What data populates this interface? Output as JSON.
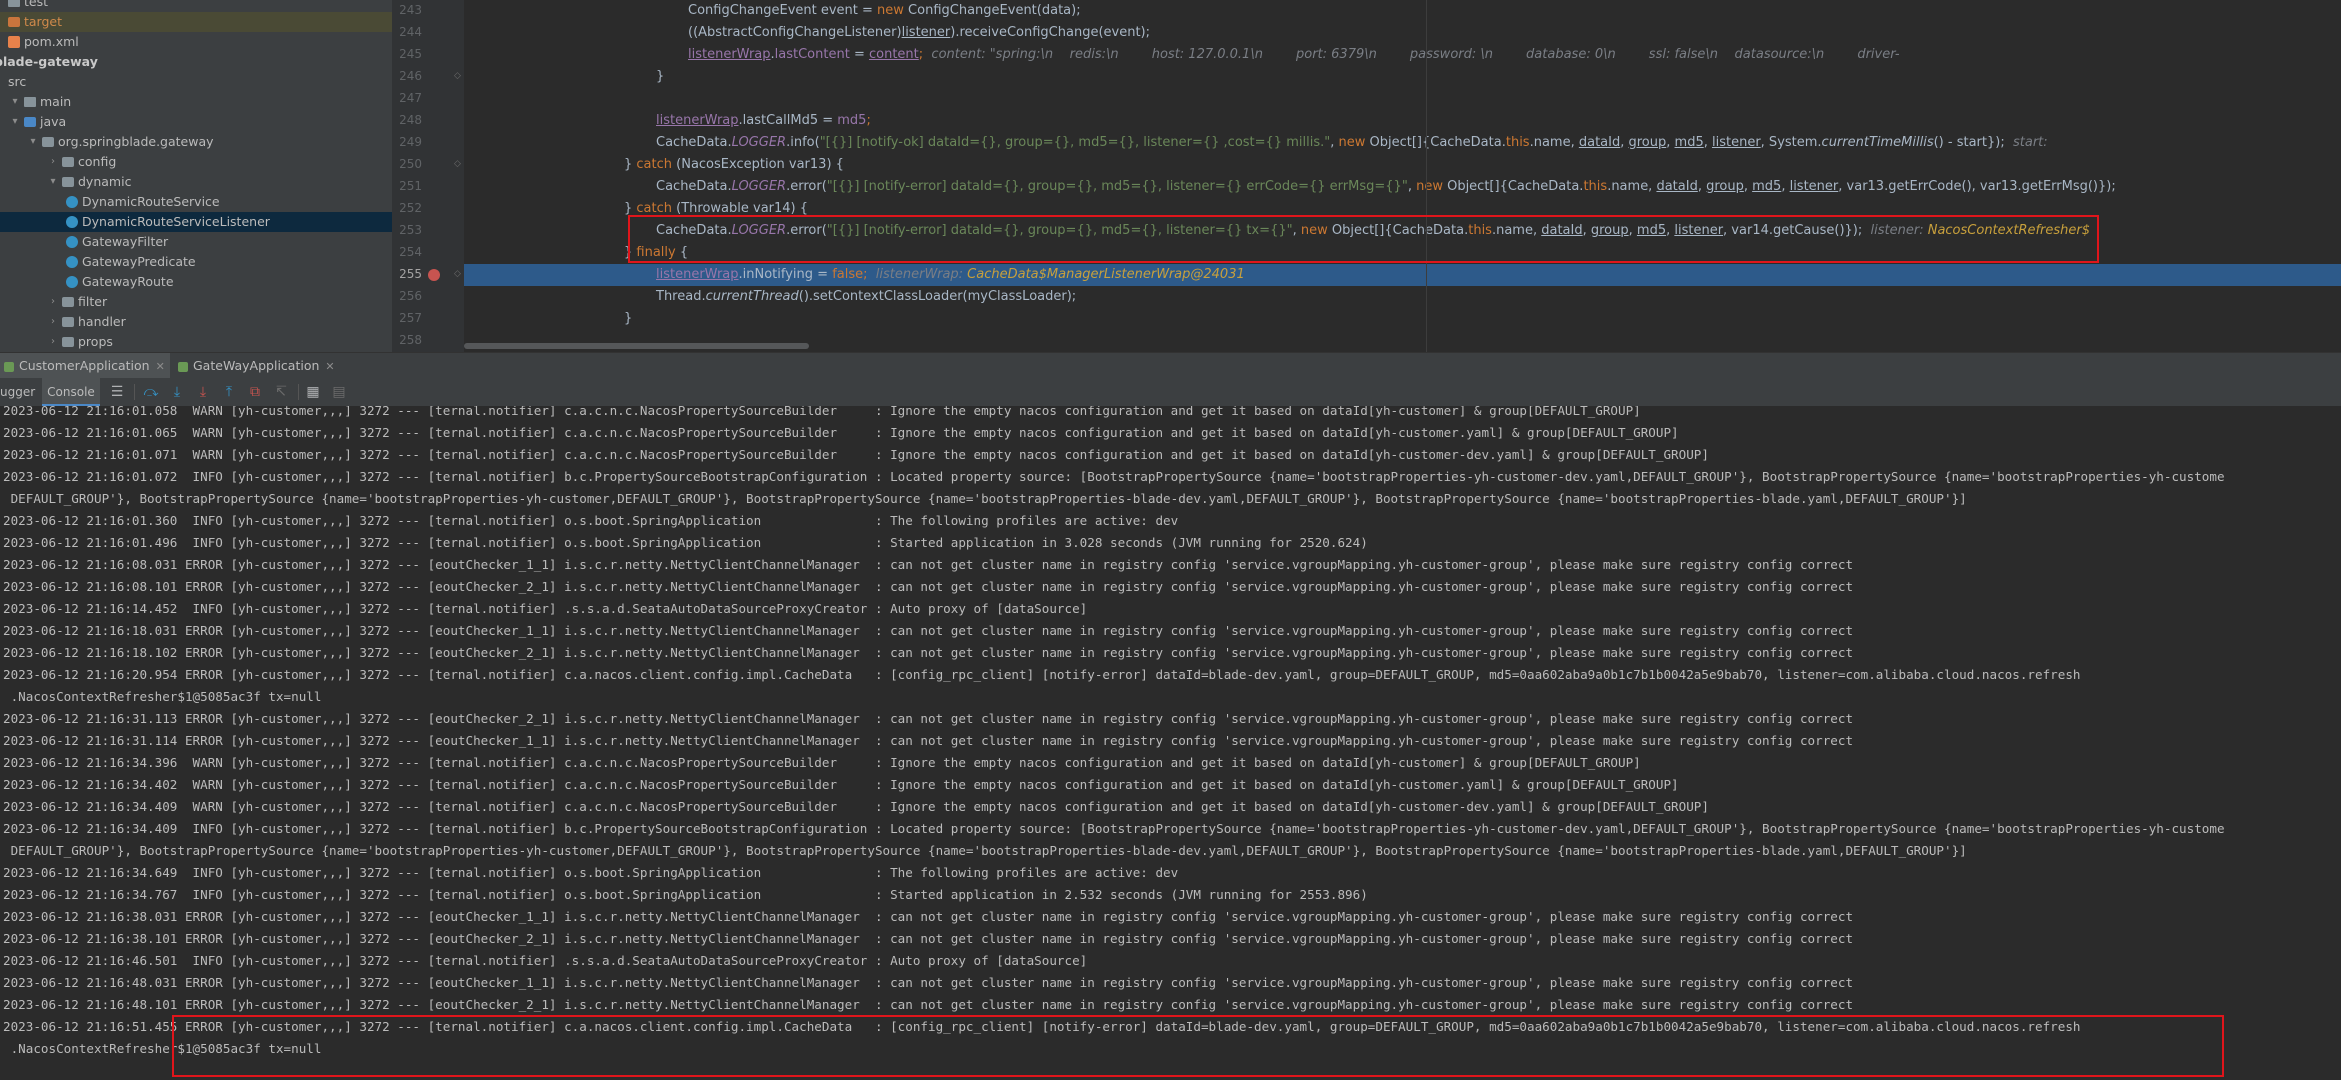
{
  "project_tree": {
    "items": [
      {
        "label": "test",
        "icon": "folder-icon",
        "depth": 0,
        "arrow": "",
        "style": ""
      },
      {
        "label": "target",
        "icon": "target-folder-icon",
        "depth": 0,
        "arrow": "",
        "style": "target"
      },
      {
        "label": "pom.xml",
        "icon": "xml-file-icon",
        "depth": 0,
        "arrow": "",
        "style": ""
      },
      {
        "label": "blade-gateway",
        "icon": "",
        "depth": 0,
        "arrow": "",
        "style": "bold"
      },
      {
        "label": "src",
        "icon": "",
        "depth": 0,
        "arrow": "",
        "style": ""
      },
      {
        "label": "main",
        "icon": "folder-icon",
        "depth": 1,
        "arrow": "▾",
        "style": ""
      },
      {
        "label": "java",
        "icon": "source-folder-icon",
        "depth": 1,
        "arrow": "▾",
        "style": ""
      },
      {
        "label": "org.springblade.gateway",
        "icon": "package-icon",
        "depth": 2,
        "arrow": "▾",
        "style": ""
      },
      {
        "label": "config",
        "icon": "package-icon",
        "depth": 3,
        "arrow": "›",
        "style": ""
      },
      {
        "label": "dynamic",
        "icon": "package-icon",
        "depth": 3,
        "arrow": "▾",
        "style": ""
      },
      {
        "label": "DynamicRouteService",
        "icon": "class-icon",
        "depth": 4,
        "arrow": "",
        "style": ""
      },
      {
        "label": "DynamicRouteServiceListener",
        "icon": "class-icon",
        "depth": 4,
        "arrow": "",
        "style": "selected"
      },
      {
        "label": "GatewayFilter",
        "icon": "class-icon",
        "depth": 4,
        "arrow": "",
        "style": ""
      },
      {
        "label": "GatewayPredicate",
        "icon": "class-icon",
        "depth": 4,
        "arrow": "",
        "style": ""
      },
      {
        "label": "GatewayRoute",
        "icon": "class-icon",
        "depth": 4,
        "arrow": "",
        "style": ""
      },
      {
        "label": "filter",
        "icon": "package-icon",
        "depth": 3,
        "arrow": "›",
        "style": ""
      },
      {
        "label": "handler",
        "icon": "package-icon",
        "depth": 3,
        "arrow": "›",
        "style": ""
      },
      {
        "label": "props",
        "icon": "package-icon",
        "depth": 3,
        "arrow": "›",
        "style": ""
      }
    ]
  },
  "editor": {
    "line_numbers": [
      "243",
      "244",
      "245",
      "246",
      "247",
      "248",
      "249",
      "250",
      "251",
      "252",
      "253",
      "254",
      "255",
      "256",
      "257",
      "258"
    ],
    "current_line": "255",
    "l243": {
      "a": "ConfigChangeEvent event = ",
      "new": "new",
      "b": " ConfigChangeEvent(data);"
    },
    "l244": {
      "a": "((AbstractConfigChangeListener)",
      "listener": "listener",
      "b": ").receiveConfigChange(event);"
    },
    "l245": {
      "w": "listenerWrap",
      "a": ".",
      "f": "lastContent",
      "b": " = ",
      "c": "content",
      "d": ";",
      "hint": "content: \"spring:\\n    redis:\\n        host: 127.0.0.1\\n        port: 6379\\n        password: \\n        database: 0\\n        ssl: false\\n    datasource:\\n        driver-"
    },
    "l246": {
      "a": "}"
    },
    "l248": {
      "w": "listenerWrap",
      "a": ".lastCallMd5 = ",
      "f": "md5",
      "b": ";"
    },
    "l249": {
      "a": "CacheData.",
      "logger": "LOGGER",
      "b": ".info(",
      "s": "\"[{}] [notify-ok] dataId={}, group={}, md5={}, listener={} ,cost={} millis.\"",
      "c": ", ",
      "new": "new",
      "d": " Object[]{CacheData.",
      "this": "this",
      "e": ".name, ",
      "v1": "dataId",
      "v2": "group",
      "v3": "md5",
      "v4": "listener",
      "g": ", System.",
      "ctm": "currentTimeMillis",
      "h": "() - start});",
      "hint": "start: "
    },
    "l250": {
      "a": "} ",
      "catch": "catch",
      "b": " (NacosException var13) {"
    },
    "l251": {
      "a": "CacheData.",
      "logger": "LOGGER",
      "b": ".error(",
      "s": "\"[{}] [notify-error] dataId={}, group={}, md5={}, listener={} errCode={} errMsg={}\"",
      "c": ", ",
      "new": "new",
      "d": " Object[]{CacheData.",
      "this": "this",
      "e": ".name, ",
      "v1": "dataId",
      "v2": "group",
      "v3": "md5",
      "v4": "listener",
      "g": ", var13.getErrCode(), var13.getErrMsg()});"
    },
    "l252": {
      "a": "} ",
      "catch": "catch",
      "b": " (Throwable var14) {"
    },
    "l253": {
      "a": "CacheData.",
      "logger": "LOGGER",
      "b": ".error(",
      "s": "\"[{}] [notify-error] dataId={}, group={}, md5={}, listener={} tx={}\"",
      "c": ", ",
      "new": "new",
      "d": " Object[]{CacheData.",
      "this": "this",
      "e": ".name, ",
      "v1": "dataId",
      "v2": "group",
      "v3": "md5",
      "v4": "listener",
      "g": ", var14.getCause()});",
      "hint": "listener: ",
      "hintc": "NacosContextRefresher$"
    },
    "l254": {
      "a": "} ",
      "finally": "finally",
      "b": " {"
    },
    "l255": {
      "w": "listenerWrap",
      "a": ".inNotifying = ",
      "false": "false",
      "b": ";",
      "hint": "listenerWrap: ",
      "hintc": "CacheData$ManagerListenerWrap@24031"
    },
    "l256": {
      "a": "Thread.",
      "ct": "currentThread",
      "b": "().setContextClassLoader(myClassLoader);"
    },
    "l257": {
      "a": "}"
    }
  },
  "run_tabs": [
    {
      "label": "CustomerApplication",
      "active": true
    },
    {
      "label": "GateWayApplication",
      "active": false
    }
  ],
  "toolbar": {
    "debugger_label": "ugger",
    "console_label": "Console"
  },
  "console_lines": [
    "2023-06-12 21:16:01.058  WARN [yh-customer,,,] 3272 --- [ternal.notifier] c.a.c.n.c.NacosPropertySourceBuilder     : Ignore the empty nacos configuration and get it based on dataId[yh-customer] & group[DEFAULT_GROUP]",
    "2023-06-12 21:16:01.065  WARN [yh-customer,,,] 3272 --- [ternal.notifier] c.a.c.n.c.NacosPropertySourceBuilder     : Ignore the empty nacos configuration and get it based on dataId[yh-customer.yaml] & group[DEFAULT_GROUP]",
    "2023-06-12 21:16:01.071  WARN [yh-customer,,,] 3272 --- [ternal.notifier] c.a.c.n.c.NacosPropertySourceBuilder     : Ignore the empty nacos configuration and get it based on dataId[yh-customer-dev.yaml] & group[DEFAULT_GROUP]",
    "2023-06-12 21:16:01.072  INFO [yh-customer,,,] 3272 --- [ternal.notifier] b.c.PropertySourceBootstrapConfiguration : Located property source: [BootstrapPropertySource {name='bootstrapProperties-yh-customer-dev.yaml,DEFAULT_GROUP'}, BootstrapPropertySource {name='bootstrapProperties-yh-custome",
    " DEFAULT_GROUP'}, BootstrapPropertySource {name='bootstrapProperties-yh-customer,DEFAULT_GROUP'}, BootstrapPropertySource {name='bootstrapProperties-blade-dev.yaml,DEFAULT_GROUP'}, BootstrapPropertySource {name='bootstrapProperties-blade.yaml,DEFAULT_GROUP'}]",
    "2023-06-12 21:16:01.360  INFO [yh-customer,,,] 3272 --- [ternal.notifier] o.s.boot.SpringApplication               : The following profiles are active: dev",
    "2023-06-12 21:16:01.496  INFO [yh-customer,,,] 3272 --- [ternal.notifier] o.s.boot.SpringApplication               : Started application in 3.028 seconds (JVM running for 2520.624)",
    "2023-06-12 21:16:08.031 ERROR [yh-customer,,,] 3272 --- [eoutChecker_1_1] i.s.c.r.netty.NettyClientChannelManager  : can not get cluster name in registry config 'service.vgroupMapping.yh-customer-group', please make sure registry config correct",
    "2023-06-12 21:16:08.101 ERROR [yh-customer,,,] 3272 --- [eoutChecker_2_1] i.s.c.r.netty.NettyClientChannelManager  : can not get cluster name in registry config 'service.vgroupMapping.yh-customer-group', please make sure registry config correct",
    "2023-06-12 21:16:14.452  INFO [yh-customer,,,] 3272 --- [ternal.notifier] .s.s.a.d.SeataAutoDataSourceProxyCreator : Auto proxy of [dataSource]",
    "2023-06-12 21:16:18.031 ERROR [yh-customer,,,] 3272 --- [eoutChecker_1_1] i.s.c.r.netty.NettyClientChannelManager  : can not get cluster name in registry config 'service.vgroupMapping.yh-customer-group', please make sure registry config correct",
    "2023-06-12 21:16:18.102 ERROR [yh-customer,,,] 3272 --- [eoutChecker_2_1] i.s.c.r.netty.NettyClientChannelManager  : can not get cluster name in registry config 'service.vgroupMapping.yh-customer-group', please make sure registry config correct",
    "2023-06-12 21:16:20.954 ERROR [yh-customer,,,] 3272 --- [ternal.notifier] c.a.nacos.client.config.impl.CacheData   : [config_rpc_client] [notify-error] dataId=blade-dev.yaml, group=DEFAULT_GROUP, md5=0aa602aba9a0b1c7b1b0042a5e9bab70, listener=com.alibaba.cloud.nacos.refresh",
    " .NacosContextRefresher$1@5085ac3f tx=null",
    "2023-06-12 21:16:31.113 ERROR [yh-customer,,,] 3272 --- [eoutChecker_2_1] i.s.c.r.netty.NettyClientChannelManager  : can not get cluster name in registry config 'service.vgroupMapping.yh-customer-group', please make sure registry config correct",
    "2023-06-12 21:16:31.114 ERROR [yh-customer,,,] 3272 --- [eoutChecker_1_1] i.s.c.r.netty.NettyClientChannelManager  : can not get cluster name in registry config 'service.vgroupMapping.yh-customer-group', please make sure registry config correct",
    "2023-06-12 21:16:34.396  WARN [yh-customer,,,] 3272 --- [ternal.notifier] c.a.c.n.c.NacosPropertySourceBuilder     : Ignore the empty nacos configuration and get it based on dataId[yh-customer] & group[DEFAULT_GROUP]",
    "2023-06-12 21:16:34.402  WARN [yh-customer,,,] 3272 --- [ternal.notifier] c.a.c.n.c.NacosPropertySourceBuilder     : Ignore the empty nacos configuration and get it based on dataId[yh-customer.yaml] & group[DEFAULT_GROUP]",
    "2023-06-12 21:16:34.409  WARN [yh-customer,,,] 3272 --- [ternal.notifier] c.a.c.n.c.NacosPropertySourceBuilder     : Ignore the empty nacos configuration and get it based on dataId[yh-customer-dev.yaml] & group[DEFAULT_GROUP]",
    "2023-06-12 21:16:34.409  INFO [yh-customer,,,] 3272 --- [ternal.notifier] b.c.PropertySourceBootstrapConfiguration : Located property source: [BootstrapPropertySource {name='bootstrapProperties-yh-customer-dev.yaml,DEFAULT_GROUP'}, BootstrapPropertySource {name='bootstrapProperties-yh-custome",
    " DEFAULT_GROUP'}, BootstrapPropertySource {name='bootstrapProperties-yh-customer,DEFAULT_GROUP'}, BootstrapPropertySource {name='bootstrapProperties-blade-dev.yaml,DEFAULT_GROUP'}, BootstrapPropertySource {name='bootstrapProperties-blade.yaml,DEFAULT_GROUP'}]",
    "2023-06-12 21:16:34.649  INFO [yh-customer,,,] 3272 --- [ternal.notifier] o.s.boot.SpringApplication               : The following profiles are active: dev",
    "2023-06-12 21:16:34.767  INFO [yh-customer,,,] 3272 --- [ternal.notifier] o.s.boot.SpringApplication               : Started application in 2.532 seconds (JVM running for 2553.896)",
    "2023-06-12 21:16:38.031 ERROR [yh-customer,,,] 3272 --- [eoutChecker_1_1] i.s.c.r.netty.NettyClientChannelManager  : can not get cluster name in registry config 'service.vgroupMapping.yh-customer-group', please make sure registry config correct",
    "2023-06-12 21:16:38.101 ERROR [yh-customer,,,] 3272 --- [eoutChecker_2_1] i.s.c.r.netty.NettyClientChannelManager  : can not get cluster name in registry config 'service.vgroupMapping.yh-customer-group', please make sure registry config correct",
    "2023-06-12 21:16:46.501  INFO [yh-customer,,,] 3272 --- [ternal.notifier] .s.s.a.d.SeataAutoDataSourceProxyCreator : Auto proxy of [dataSource]",
    "2023-06-12 21:16:48.031 ERROR [yh-customer,,,] 3272 --- [eoutChecker_1_1] i.s.c.r.netty.NettyClientChannelManager  : can not get cluster name in registry config 'service.vgroupMapping.yh-customer-group', please make sure registry config correct",
    "2023-06-12 21:16:48.101 ERROR [yh-customer,,,] 3272 --- [eoutChecker_2_1] i.s.c.r.netty.NettyClientChannelManager  : can not get cluster name in registry config 'service.vgroupMapping.yh-customer-group', please make sure registry config correct",
    "2023-06-12 21:16:51.455 ERROR [yh-customer,,,] 3272 --- [ternal.notifier] c.a.nacos.client.config.impl.CacheData   : [config_rpc_client] [notify-error] dataId=blade-dev.yaml, group=DEFAULT_GROUP, md5=0aa602aba9a0b1c7b1b0042a5e9bab70, listener=com.alibaba.cloud.nacos.refresh",
    " .NacosContextRefresher$1@5085ac3f tx=null"
  ]
}
